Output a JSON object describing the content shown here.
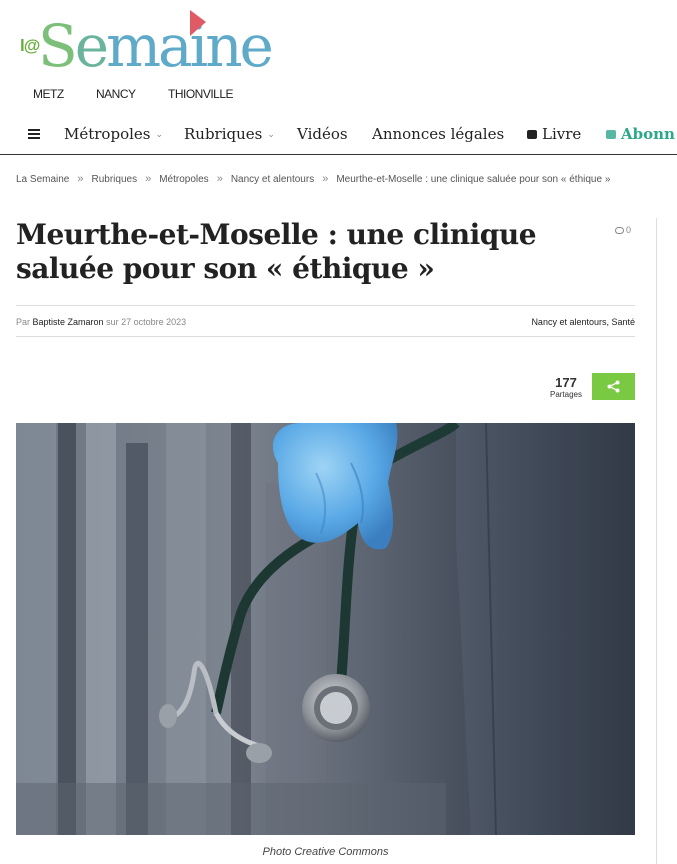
{
  "brand": {
    "logo_prefix": "l@",
    "logo_word_parts": [
      "S",
      "e",
      "maine"
    ],
    "cities": [
      "METZ",
      "NANCY",
      "THIONVILLE"
    ]
  },
  "nav": {
    "items": [
      {
        "label": "Métropoles",
        "has_dropdown": true
      },
      {
        "label": "Rubriques",
        "has_dropdown": true
      },
      {
        "label": "Vidéos",
        "has_dropdown": false
      },
      {
        "label": "Annonces légales",
        "has_dropdown": false
      },
      {
        "label": "Livre",
        "icon": "shopping-bag-icon"
      },
      {
        "label": "Abonn",
        "icon": "shopping-bag-icon"
      }
    ]
  },
  "breadcrumb": [
    "La Semaine",
    "Rubriques",
    "Métropoles",
    "Nancy et alentours",
    "Meurthe-et-Moselle : une clinique saluée pour son « éthique »"
  ],
  "article": {
    "title": "Meurthe-et-Moselle : une clinique saluée pour son « éthique »",
    "comment_count": "0",
    "by_prefix": "Par",
    "author": "Baptiste Zamaron",
    "date_prefix": "sur",
    "date": "27 octobre 2023",
    "categories": "Nancy et alentours, Santé",
    "share_count": "177",
    "share_label": "Partages",
    "photo_caption": "Photo Creative Commons"
  },
  "colors": {
    "share_green": "#7ac943",
    "subscribe_green": "#2aa889",
    "logo_blue": "#5fa9c9",
    "logo_red": "#e05a66"
  }
}
